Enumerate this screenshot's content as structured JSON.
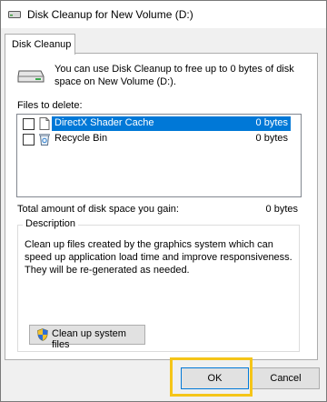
{
  "window": {
    "title": "Disk Cleanup for New Volume (D:)"
  },
  "tabs": [
    {
      "label": "Disk Cleanup"
    }
  ],
  "intro": {
    "text": "You can use Disk Cleanup to free up to 0 bytes of disk space on New Volume (D:)."
  },
  "files": {
    "label": "Files to delete:",
    "items": [
      {
        "label": "DirectX Shader Cache",
        "size": "0 bytes",
        "checked": false,
        "selected": true,
        "icon": "file-icon"
      },
      {
        "label": "Recycle Bin",
        "size": "0 bytes",
        "checked": false,
        "selected": false,
        "icon": "recycle-bin-icon"
      }
    ]
  },
  "total": {
    "label": "Total amount of disk space you gain:",
    "value": "0 bytes"
  },
  "description": {
    "legend": "Description",
    "text": "Clean up files created by the graphics system which can speed up application load time and improve responsiveness. They will be re-generated as needed.",
    "cleanup_button": "Clean up system files"
  },
  "buttons": {
    "ok": "OK",
    "cancel": "Cancel"
  },
  "colors": {
    "selection": "#0078d7",
    "highlight_box": "#f5c518"
  }
}
